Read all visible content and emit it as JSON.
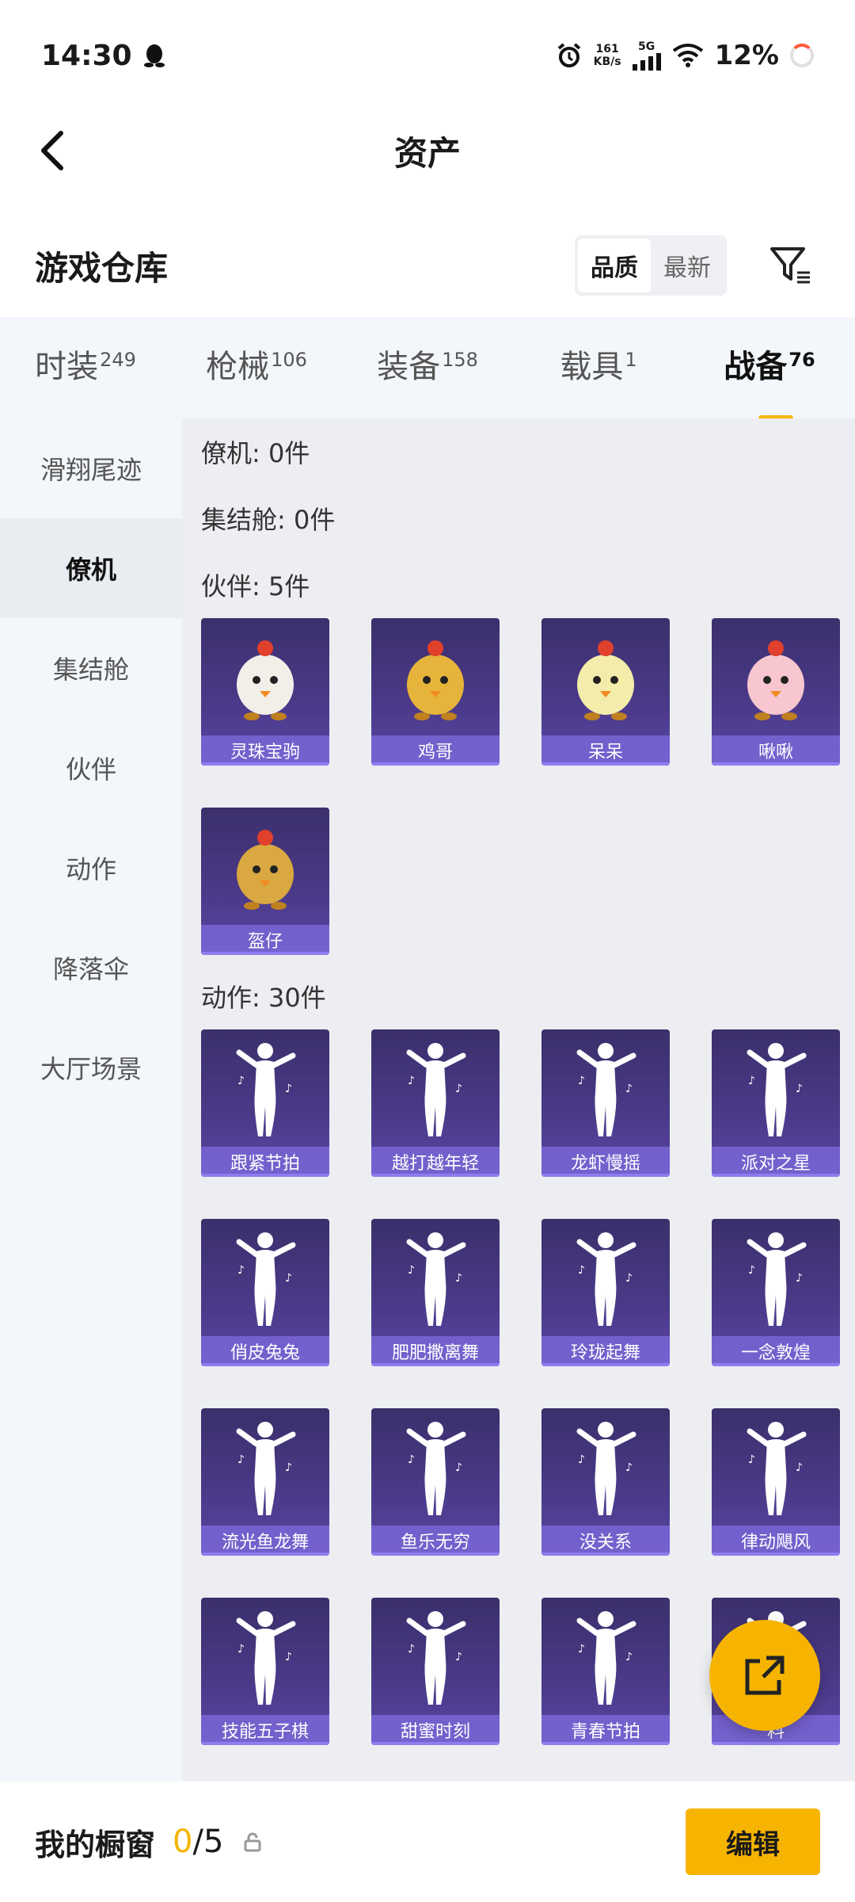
{
  "status_bar": {
    "time": "14:30",
    "net_speed_value": "161",
    "net_speed_unit": "KB/s",
    "network": "5G",
    "battery": "12%"
  },
  "header": {
    "title": "资产"
  },
  "warehouse": {
    "title": "游戏仓库",
    "sort_options": [
      "品质",
      "最新"
    ],
    "sort_active": "品质"
  },
  "category_tabs": [
    {
      "label": "时装",
      "count": "249"
    },
    {
      "label": "枪械",
      "count": "106"
    },
    {
      "label": "装备",
      "count": "158"
    },
    {
      "label": "载具",
      "count": "1"
    },
    {
      "label": "战备",
      "count": "76",
      "active": true
    }
  ],
  "side_menu": [
    {
      "label": "滑翔尾迹"
    },
    {
      "label": "僚机",
      "active": true
    },
    {
      "label": "集结舱"
    },
    {
      "label": "伙伴"
    },
    {
      "label": "动作"
    },
    {
      "label": "降落伞"
    },
    {
      "label": "大厅场景"
    }
  ],
  "sections": {
    "wingman": "僚机: 0件",
    "pod": "集结舱: 0件",
    "partner": "伙伴: 5件",
    "emote": "动作: 30件"
  },
  "partners": [
    "灵珠宝驹",
    "鸡哥",
    "呆呆",
    "啾啾",
    "盔仔"
  ],
  "emotes": [
    "跟紧节拍",
    "越打越年轻",
    "龙虾慢摇",
    "派对之星",
    "俏皮兔兔",
    "肥肥撒离舞",
    "玲珑起舞",
    "一念敦煌",
    "流光鱼龙舞",
    "鱼乐无穷",
    "没关系",
    "律动飓风",
    "技能五子棋",
    "甜蜜时刻",
    "青春节拍",
    "料"
  ],
  "bottom_bar": {
    "title": "我的橱窗",
    "count_current": "0",
    "count_total": "/5",
    "edit_label": "编辑"
  },
  "colors": {
    "accent": "#f6b400",
    "card_bg": "#4b3a8a"
  }
}
